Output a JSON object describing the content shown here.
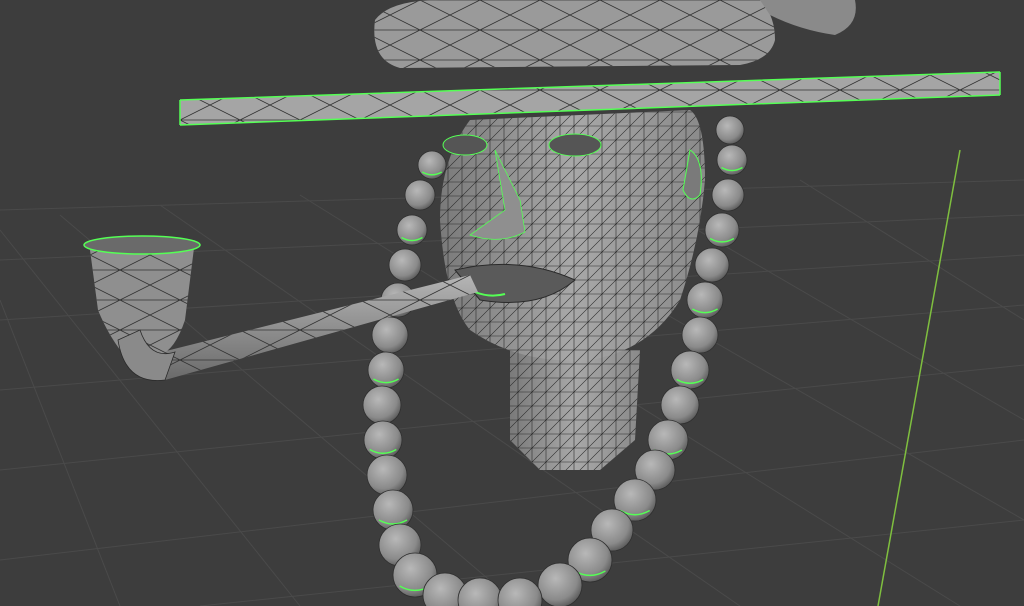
{
  "viewport": {
    "background": "#3d3d3d",
    "grid_color": "#4a4a4a",
    "y_axis_color": "#7fbf3f",
    "mesh_fill": "#9a9a9a",
    "mesh_shadow": "#6e6e6e",
    "wire_color": "#2a2a2a",
    "seam_color": "#55ff55",
    "objects": [
      "hat",
      "head",
      "pipe",
      "bead-necklace"
    ]
  }
}
